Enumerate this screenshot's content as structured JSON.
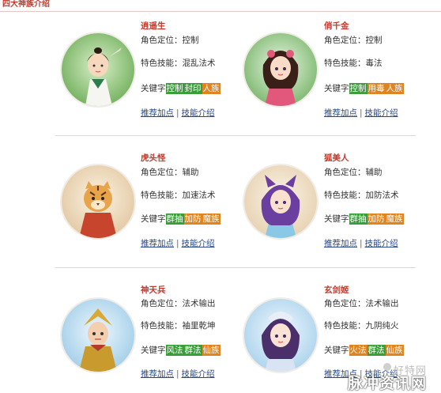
{
  "section_title": "四大神族介绍",
  "characters": [
    {
      "name": "逍遥生",
      "role_label": "角色定位：控制",
      "skill_label": "特色技能：混乱法术",
      "keyword_label": "关键字",
      "tags": [
        "控制",
        "封印",
        "人族"
      ],
      "link_points": "推荐加点",
      "link_skills": "技能介绍"
    },
    {
      "name": "俏千金",
      "role_label": "角色定位：控制",
      "skill_label": "特色技能：毒法",
      "keyword_label": "关键字",
      "tags": [
        "控制",
        "用毒",
        "人族"
      ],
      "link_points": "推荐加点",
      "link_skills": "技能介绍"
    },
    {
      "name": "虎头怪",
      "role_label": "角色定位：辅助",
      "skill_label": "特色技能：加速法术",
      "keyword_label": "关键字",
      "tags": [
        "群抽",
        "加防",
        "魔族"
      ],
      "link_points": "推荐加点",
      "link_skills": "技能介绍"
    },
    {
      "name": "狐美人",
      "role_label": "角色定位：辅助",
      "skill_label": "特色技能：加防法术",
      "keyword_label": "关键字",
      "tags": [
        "群抽",
        "加防",
        "魔族"
      ],
      "link_points": "推荐加点",
      "link_skills": "技能介绍"
    },
    {
      "name": "神天兵",
      "role_label": "角色定位：法术输出",
      "skill_label": "特色技能：袖里乾坤",
      "keyword_label": "关键字",
      "tags": [
        "风法",
        "群法",
        "仙族"
      ],
      "link_points": "推荐加点",
      "link_skills": "技能介绍"
    },
    {
      "name": "玄剑姬",
      "role_label": "角色定位：法术输出",
      "skill_label": "特色技能：九阴纯火",
      "keyword_label": "关键字",
      "tags": [
        "火法",
        "群法",
        "仙族"
      ],
      "link_points": "推荐加点",
      "link_skills": "技能介绍"
    }
  ],
  "watermark": {
    "small": "好特网",
    "big": "脉冲资讯网"
  }
}
